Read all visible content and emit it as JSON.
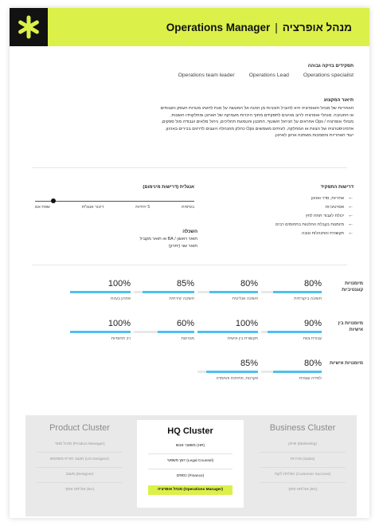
{
  "header": {
    "title_en": "Operations Manager",
    "separator": "|",
    "title_he": "מנהל אופרציה",
    "accent_color": "#dcf04a",
    "logo_icon": "asterisk-icon"
  },
  "roles": {
    "heading": "תפקידים בזיקה גבוהה",
    "items": [
      "Operations specialist",
      "Operations Lead",
      "Operations team leader"
    ]
  },
  "description": {
    "heading": "תיאור המקצוע",
    "lines": [
      "האחריות של מנהל האופרציה היא להוביל תוכניות מן ההנה אל המעשה על מנת להשיג מטרות העסק והצוותים",
      "או החטיבה. מנהלי אופרציה לרוב מגיעים לתפקידם מתוך היכרות מעמיקה של הארגון ומחלקותיו השונות.",
      "מנהלי אופרציה / Ops אחראים על הניהול השוטף, התכנון והטמעת תהליכים, ניהול מלאים ועבודה מול ספקים,",
      "אדמיניסטרציה של הצוות או המחלקה, לעיתים משמשים Ops כחלק מהנהלה ויועצים לדרגים בכירים בארגון.",
      "יעוד האחריות והסמכות משתנה ארגון לארגון."
    ]
  },
  "requirements": {
    "heading": "דרישות התפקיד",
    "items": [
      "אחריות, סדר וארגון",
      "אסרטיביות",
      "יכולת לעבוד תחת לחץ",
      "מיומנות בקבלת החלטות בתחומים רבים",
      "תקשורת והתנהלות טובה"
    ]
  },
  "english": {
    "heading": "אנגלית (דרישות מינימום)",
    "levels": [
      "בסיסית",
      "5 יחידות",
      "דיבור אנגלית",
      "שפת אם"
    ],
    "selected_index": 2
  },
  "education": {
    "heading": "השכלה",
    "lines": [
      "תואר ראשון / BA או תואר מקביל",
      "תואר שני (יתרון)"
    ]
  },
  "skills": [
    {
      "label": "מיומנויות קוגנטיביות",
      "items": [
        {
          "name": "חשיבה ביקורתית",
          "value": "80%",
          "pct": 80
        },
        {
          "name": "חשיבה אנליטית",
          "value": "80%",
          "pct": 80
        },
        {
          "name": "חשיבה יצירתית",
          "value": "85%",
          "pct": 85
        },
        {
          "name": "פתרון בעיות",
          "value": "100%",
          "pct": 100
        }
      ]
    },
    {
      "label": "מיומנויות בין אישיות",
      "items": [
        {
          "name": "עבודת צוות",
          "value": "90%",
          "pct": 90
        },
        {
          "name": "תקשורת בין אישית",
          "value": "100%",
          "pct": 100
        },
        {
          "name": "מנהיגות",
          "value": "60%",
          "pct": 60
        },
        {
          "name": "רב תחומיות",
          "value": "100%",
          "pct": 100
        }
      ]
    },
    {
      "label": "מיומנויות אישיות",
      "items": [
        {
          "name": "למידה עצמית",
          "value": "80%",
          "pct": 80
        },
        {
          "name": "סקרנות, פתיחות והתמדה",
          "value": "85%",
          "pct": 85
        }
      ]
    }
  ],
  "clusters": [
    {
      "title": "Product Cluster",
      "items": [
        "מנהל מוצר (Product Manager)",
        "מעצב חוויית משתמש (UX Designer)",
        "מעצב (Designer)",
        "אנליסט עסקי (BA)"
      ]
    },
    {
      "title": "HQ Cluster",
      "items": [
        "משאבי אנוש (HR)",
        "יועץ משפטי (Legal Counsel)",
        "כספים (Finance)",
        "מנהל אופרציה (Operations Manager)"
      ],
      "highlight_index": 3
    },
    {
      "title": "Business Cluster",
      "items": [
        "שיווק (Marketing)",
        "מכירות (Sales)",
        "הצלחת לקוח (Customer Success)",
        "אנליסט עסקי (BA)"
      ]
    }
  ],
  "colors": {
    "bar_fill": "#4ec0ee",
    "bar_track": "#e8e8e8"
  }
}
